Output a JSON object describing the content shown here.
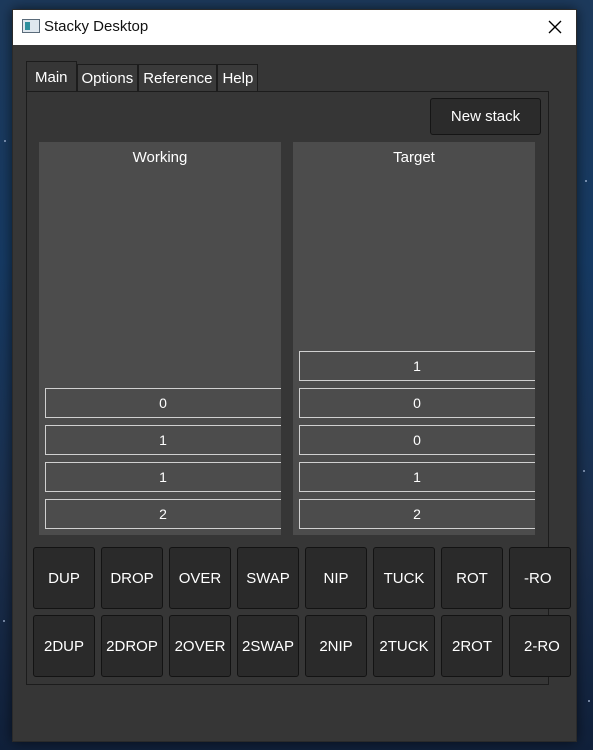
{
  "window": {
    "title": "Stacky Desktop"
  },
  "tabs": [
    {
      "label": "Main"
    },
    {
      "label": "Options"
    },
    {
      "label": "Reference"
    },
    {
      "label": "Help"
    }
  ],
  "toolbar": {
    "new_stack_label": "New stack"
  },
  "stacks": {
    "working": {
      "title": "Working",
      "items": [
        "0",
        "1",
        "1",
        "2"
      ]
    },
    "target": {
      "title": "Target",
      "items": [
        "1",
        "0",
        "0",
        "1",
        "2"
      ]
    }
  },
  "operations": {
    "row1": [
      "DUP",
      "DROP",
      "OVER",
      "SWAP",
      "NIP",
      "TUCK",
      "ROT",
      "-RO"
    ],
    "row2": [
      "2DUP",
      "2DROP",
      "2OVER",
      "2SWAP",
      "2NIP",
      "2TUCK",
      "2ROT",
      "2-RO"
    ]
  },
  "colors": {
    "window_bg": "#363636",
    "stack_bg": "#4c4c4c",
    "button_bg": "#2a2a2a",
    "titlebar_bg": "#ffffff"
  }
}
